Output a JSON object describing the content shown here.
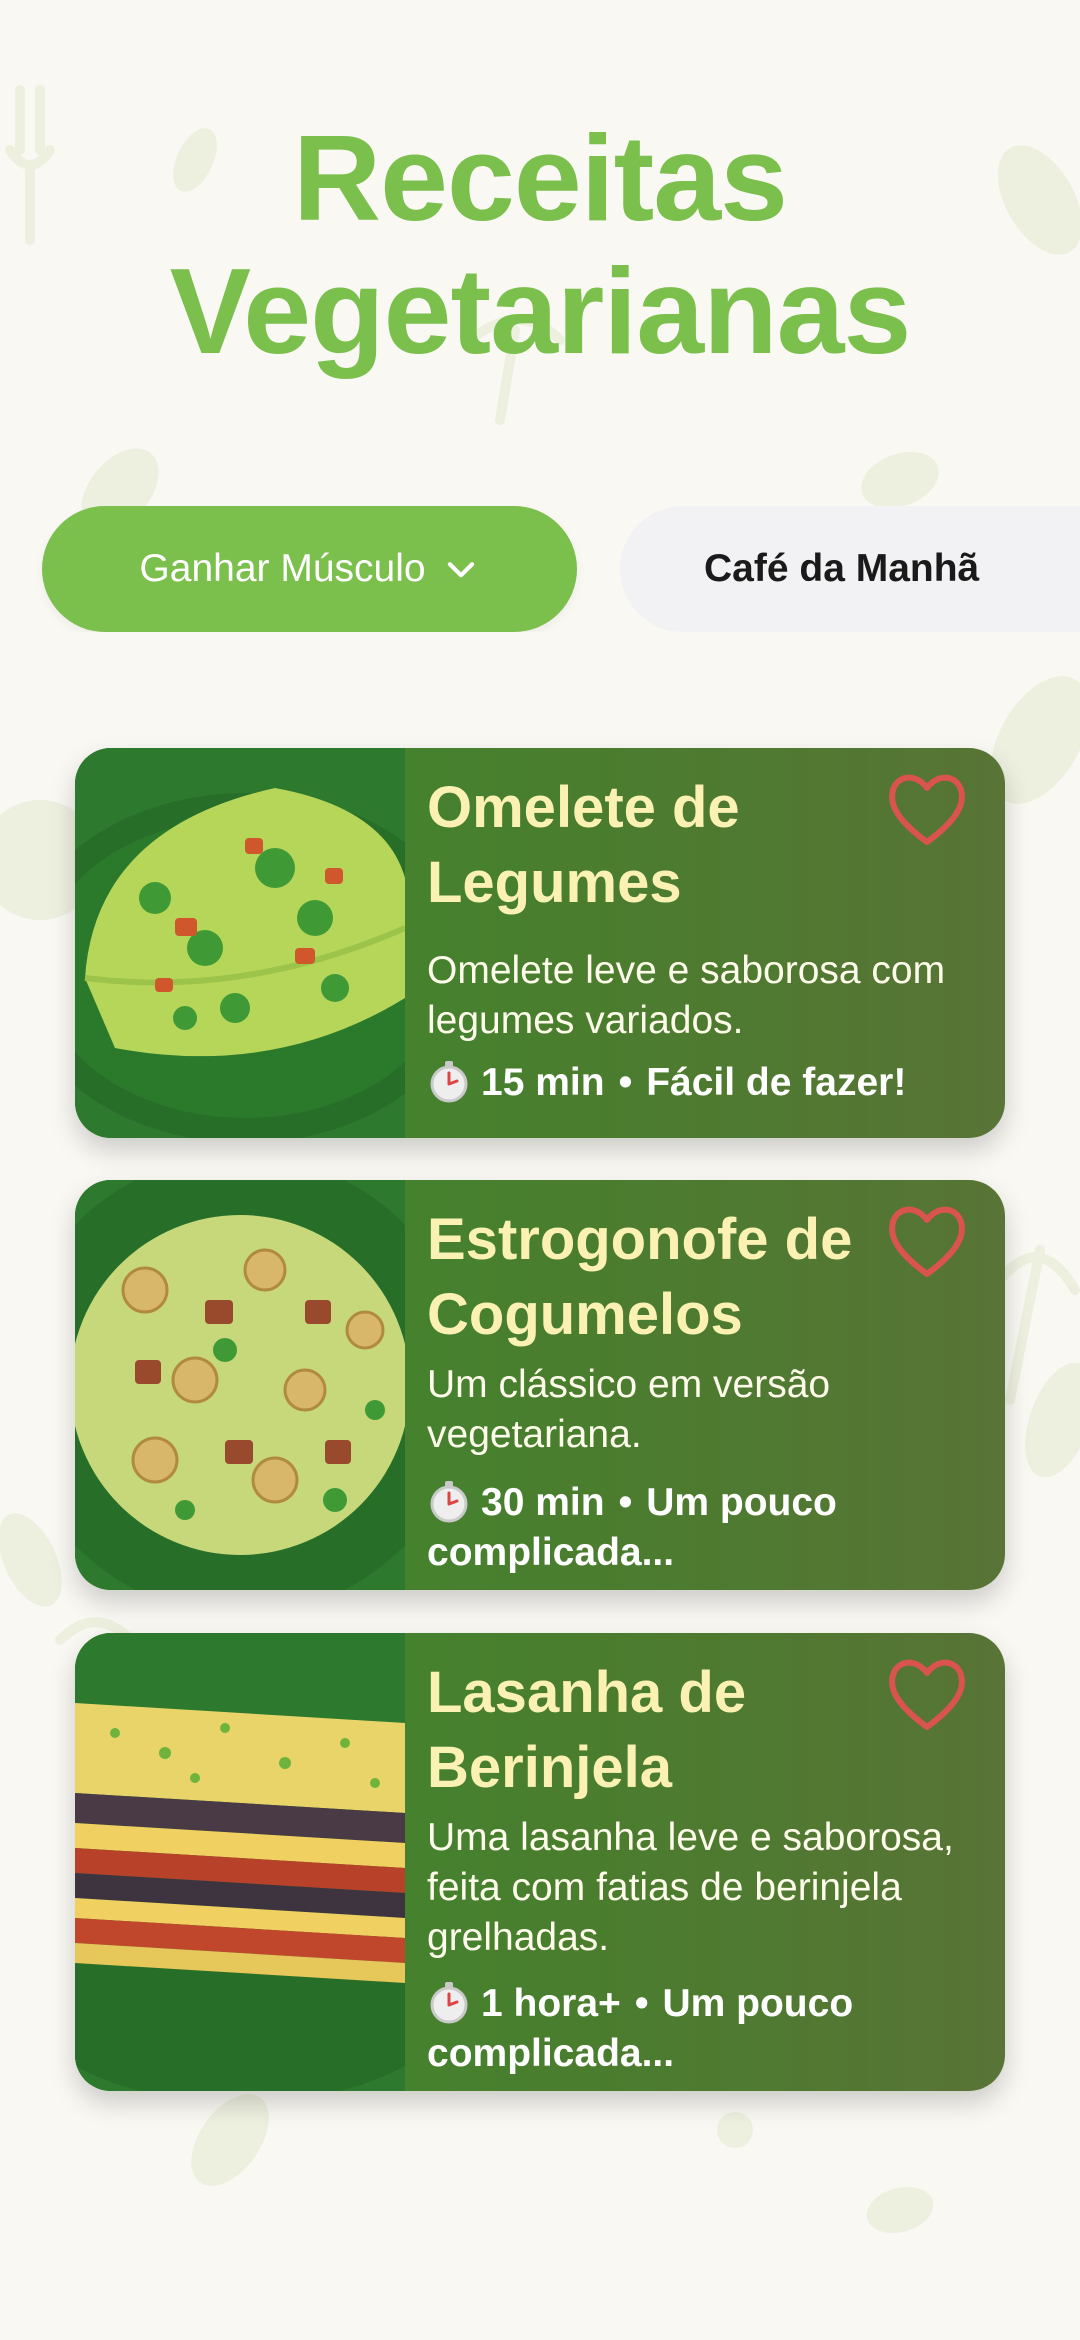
{
  "title": {
    "line1": "Receitas",
    "line2": "Vegetarianas"
  },
  "filters": {
    "primary": {
      "label": "Ganhar Músculo",
      "icon": "chevron-down-icon"
    },
    "secondary": {
      "label": "Café da Manhã"
    }
  },
  "colors": {
    "accent": "#7bbf4c",
    "card_title": "#fbf1b3",
    "heart": "#d9534f"
  },
  "recipes": [
    {
      "title": "Omelete de Legumes",
      "description": "Omelete leve e saborosa com legumes variados.",
      "time": "15 min",
      "difficulty": "Fácil de fazer!",
      "favorite": false
    },
    {
      "title": "Estrogonofe de Cogumelos",
      "description": "Um clássico em versão vegetariana.",
      "time": "30 min",
      "difficulty": "Um pouco complicada...",
      "favorite": false
    },
    {
      "title": "Lasanha de Berinjela",
      "description": "Uma lasanha leve e saborosa, feita com fatias de berinjela grelhadas.",
      "time": "1 hora+",
      "difficulty": "Um pouco complicada...",
      "favorite": false
    }
  ]
}
